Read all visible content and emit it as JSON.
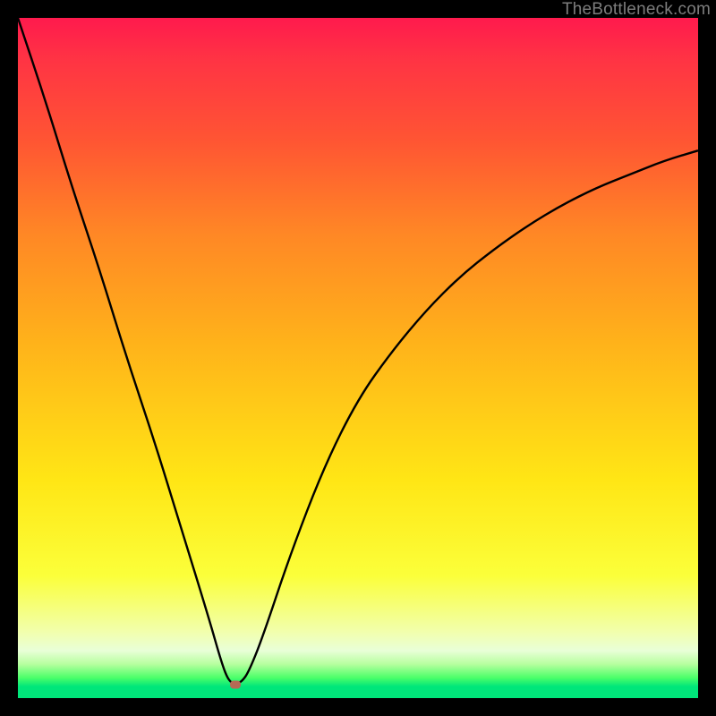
{
  "attribution": "TheBottleneck.com",
  "colors": {
    "frame": "#000000",
    "curve": "#000000",
    "marker": "#b66a55"
  },
  "chart_data": {
    "type": "line",
    "title": "",
    "xlabel": "",
    "ylabel": "",
    "x_range": [
      0,
      100
    ],
    "y_range": [
      0,
      100
    ],
    "grid": false,
    "legend": false,
    "notch": {
      "x": 32,
      "y": 2
    },
    "series": [
      {
        "name": "bottleneck-curve",
        "x": [
          0,
          4,
          8,
          12,
          16,
          20,
          24,
          28,
          30,
          31,
          32,
          33,
          34,
          36,
          40,
          45,
          50,
          55,
          60,
          65,
          70,
          75,
          80,
          85,
          90,
          95,
          100
        ],
        "y": [
          100,
          88,
          75,
          63,
          50,
          38,
          25,
          12,
          5,
          2.5,
          2,
          2.5,
          4,
          9,
          21,
          34,
          44,
          51,
          57,
          62,
          66,
          69.5,
          72.5,
          75,
          77,
          79,
          80.5
        ]
      }
    ],
    "marker_point": {
      "x": 32,
      "y": 2
    }
  }
}
